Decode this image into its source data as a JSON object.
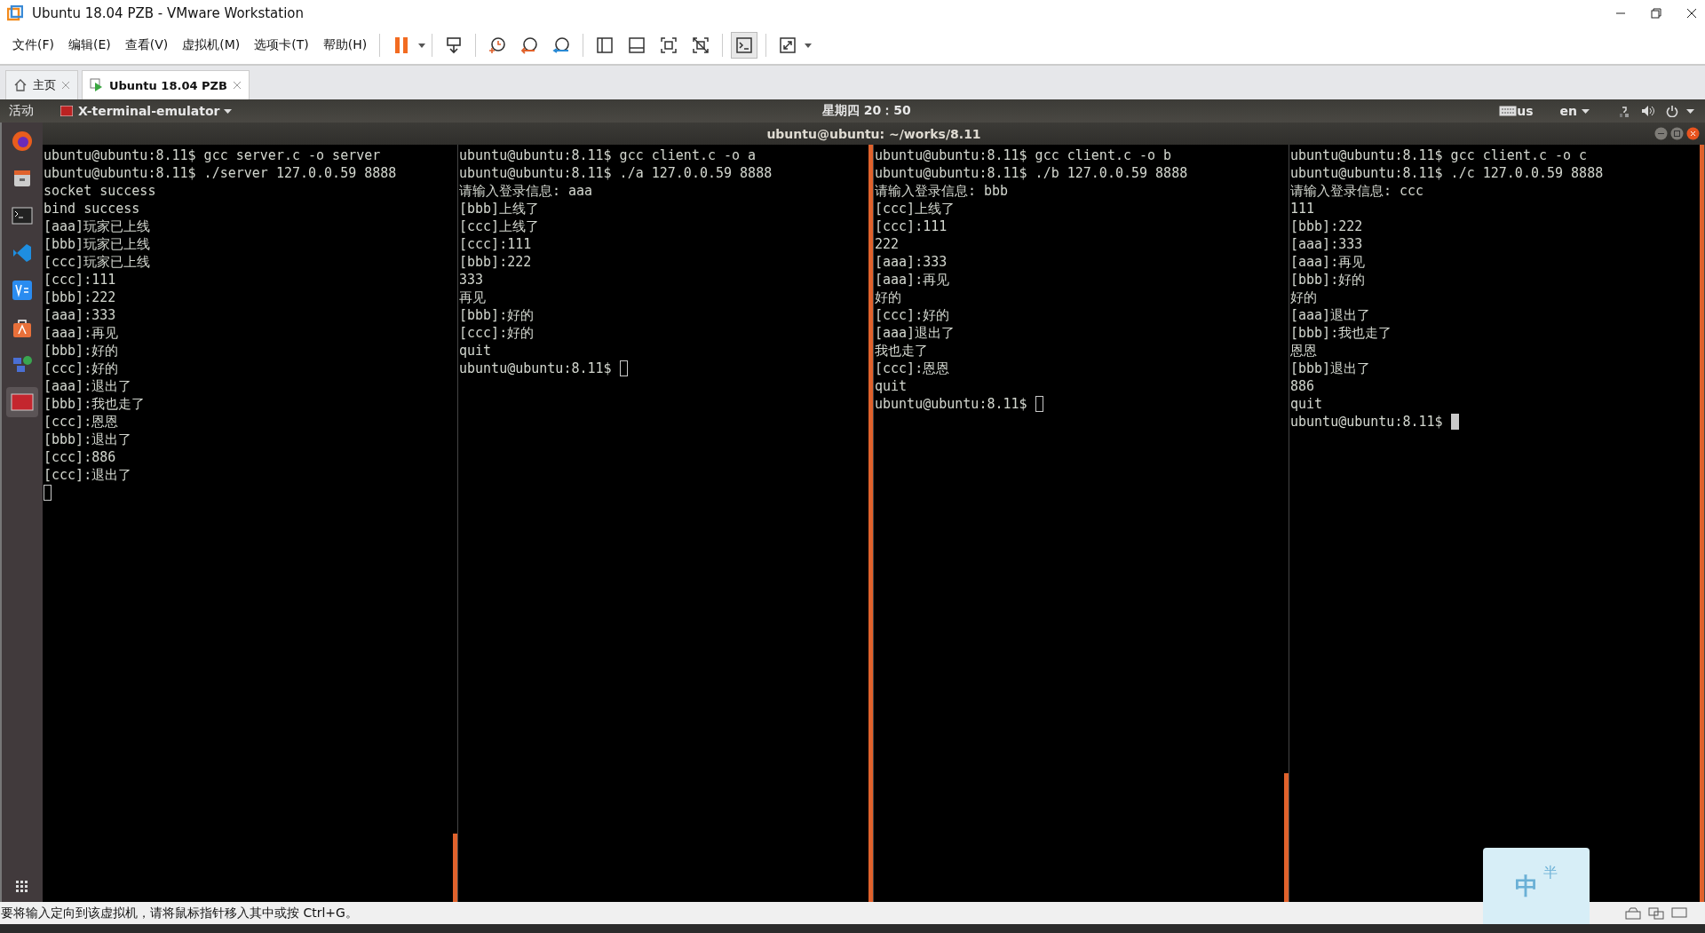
{
  "window": {
    "title": "Ubuntu 18.04 PZB - VMware Workstation"
  },
  "menu": [
    "文件(F)",
    "编辑(E)",
    "查看(V)",
    "虚拟机(M)",
    "选项卡(T)",
    "帮助(H)"
  ],
  "tabs": [
    {
      "label": "主页",
      "selected": false
    },
    {
      "label": "Ubuntu 18.04 PZB",
      "selected": true
    }
  ],
  "ubuntu_bar": {
    "activities": "活动",
    "app_menu": "X-terminal-emulator",
    "clock": "星期四 20：50",
    "keyboard": "us",
    "language": "en"
  },
  "terminal": {
    "title": "ubuntu@ubuntu: ~/works/8.11",
    "panes": [
      {
        "lines": [
          "ubuntu@ubuntu:8.11$ gcc server.c -o server",
          "ubuntu@ubuntu:8.11$ ./server 127.0.0.59 8888",
          "socket success",
          "bind success",
          "[aaa]玩家已上线",
          "[bbb]玩家已上线",
          "[ccc]玩家已上线",
          "[ccc]:111",
          "[bbb]:222",
          "[aaa]:333",
          "[aaa]:再见",
          "[bbb]:好的",
          "[ccc]:好的",
          "[aaa]:退出了",
          "[bbb]:我也走了",
          "[ccc]:恩恩",
          "[bbb]:退出了",
          "[ccc]:886",
          "[ccc]:退出了"
        ],
        "kind": "server",
        "focused": false
      },
      {
        "lines": [
          "ubuntu@ubuntu:8.11$ gcc client.c -o a",
          "ubuntu@ubuntu:8.11$ ./a 127.0.0.59 8888",
          "请输入登录信息: aaa",
          "[bbb]上线了",
          "[ccc]上线了",
          "[ccc]:111",
          "[bbb]:222",
          "333",
          "再见",
          "[bbb]:好的",
          "[ccc]:好的",
          "quit",
          "ubuntu@ubuntu:8.11$"
        ],
        "kind": "client",
        "focused": false
      },
      {
        "lines": [
          "ubuntu@ubuntu:8.11$ gcc client.c -o b",
          "ubuntu@ubuntu:8.11$ ./b 127.0.0.59 8888",
          "请输入登录信息: bbb",
          "[ccc]上线了",
          "[ccc]:111",
          "222",
          "[aaa]:333",
          "[aaa]:再见",
          "好的",
          "[ccc]:好的",
          "[aaa]退出了",
          "我也走了",
          "[ccc]:恩恩",
          "quit",
          "ubuntu@ubuntu:8.11$"
        ],
        "kind": "client",
        "focused": false
      },
      {
        "lines": [
          "ubuntu@ubuntu:8.11$ gcc client.c -o c",
          "ubuntu@ubuntu:8.11$ ./c 127.0.0.59 8888",
          "请输入登录信息: ccc",
          "111",
          "[bbb]:222",
          "[aaa]:333",
          "[aaa]:再见",
          "[bbb]:好的",
          "好的",
          "[aaa]退出了",
          "[bbb]:我也走了",
          "恩恩",
          "[bbb]退出了",
          "886",
          "quit",
          "ubuntu@ubuntu:8.11$"
        ],
        "kind": "client",
        "focused": true
      }
    ]
  },
  "status_bar": "要将输入定向到该虚拟机，请将鼠标指针移入其中或按 Ctrl+G。",
  "ime": {
    "mode": "中",
    "width": "半"
  }
}
